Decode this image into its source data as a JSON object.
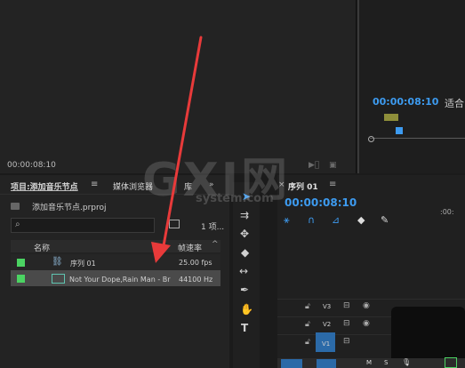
{
  "source_monitor": {
    "timecode": "00:00:08:10"
  },
  "program_monitor": {
    "timecode": "00:00:08:10",
    "fit_label": "适合"
  },
  "project_panel": {
    "tabs": [
      {
        "label": "项目:添加音乐节点",
        "active": true
      },
      {
        "label": "媒体浏览器",
        "active": false
      },
      {
        "label": "库",
        "active": false
      }
    ],
    "tab_menu_glyph": "≡",
    "overflow_glyph": "»",
    "file_name": "添加音乐节点.prproj",
    "search": {
      "value": "",
      "icon": "search-icon"
    },
    "item_count": "1 项...",
    "columns": {
      "name": "名称",
      "fps": "帧速率",
      "sort_glyph": "^"
    },
    "rows": [
      {
        "name": "序列 01",
        "fps": "25.00 fps",
        "label_color": "#4bd362",
        "icon": "sequence-icon",
        "selected": false
      },
      {
        "name": "Not Your Dope,Rain Man - Br",
        "fps": "44100 Hz",
        "label_color": "#4bd362",
        "icon": "audio-clip-icon",
        "selected": true
      }
    ]
  },
  "tools": [
    "selection-tool-icon",
    "track-select-tool-icon",
    "ripple-edit-tool-icon",
    "razor-tool-icon",
    "slip-tool-icon",
    "pen-tool-icon",
    "hand-tool-icon",
    "type-tool-icon"
  ],
  "timeline": {
    "close_glyph": "×",
    "title": "序列 01",
    "menu_glyph": "≡",
    "timecode": "00:00:08:10",
    "ruler_time": ":00:",
    "tracks": [
      {
        "name": "V3"
      },
      {
        "name": "V2"
      },
      {
        "name": "V1"
      }
    ],
    "bottom_letters": [
      "M",
      "S"
    ]
  },
  "watermark": {
    "large": "GXI网",
    "small": "system.com"
  },
  "colors": {
    "accent_blue": "#3d9bf0",
    "label_green": "#4bd362",
    "arrow_red": "#e83a3a"
  }
}
